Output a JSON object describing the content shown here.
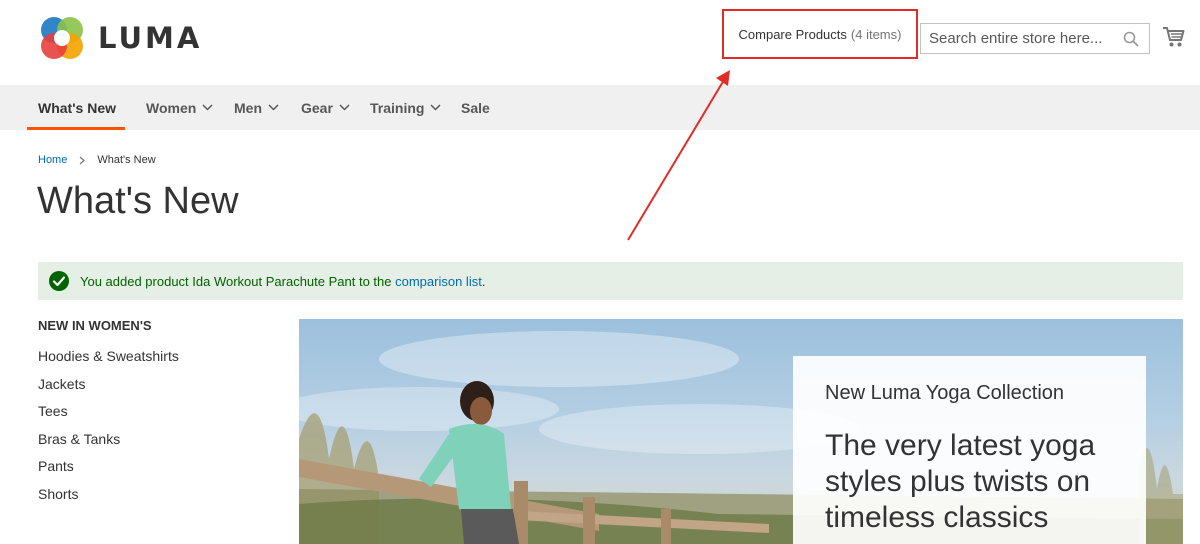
{
  "header": {
    "logo_text": "LUMA",
    "compare": {
      "label": "Compare Products",
      "count": "(4 items)"
    },
    "search": {
      "placeholder": "Search entire store here..."
    }
  },
  "nav": {
    "items": [
      {
        "label": "What's New",
        "has_dropdown": false,
        "active": true
      },
      {
        "label": "Women",
        "has_dropdown": true
      },
      {
        "label": "Men",
        "has_dropdown": true
      },
      {
        "label": "Gear",
        "has_dropdown": true
      },
      {
        "label": "Training",
        "has_dropdown": true
      },
      {
        "label": "Sale",
        "has_dropdown": false
      }
    ]
  },
  "breadcrumb": {
    "home": "Home",
    "current": "What's New"
  },
  "page_title": "What's New",
  "message": {
    "text_before": "You added product Ida Workout Parachute Pant to the ",
    "link_text": "comparison list",
    "text_after": "."
  },
  "sidebar": {
    "title": "NEW IN WOMEN'S",
    "items": [
      "Hoodies & Sweatshirts",
      "Jackets",
      "Tees",
      "Bras & Tanks",
      "Pants",
      "Shorts"
    ]
  },
  "banner": {
    "subtitle": "New Luma Yoga Collection",
    "title": "The very latest yoga styles plus twists on timeless classics"
  },
  "colors": {
    "accent": "#ff5501",
    "link": "#006bb4",
    "annotation": "#e02b27",
    "success_bg": "#e5efe5",
    "success_text": "#006400"
  },
  "icons": [
    "luma-logo-icon",
    "search-icon",
    "cart-icon",
    "chevron-down-icon",
    "check-circle-icon",
    "breadcrumb-chevron-icon"
  ]
}
